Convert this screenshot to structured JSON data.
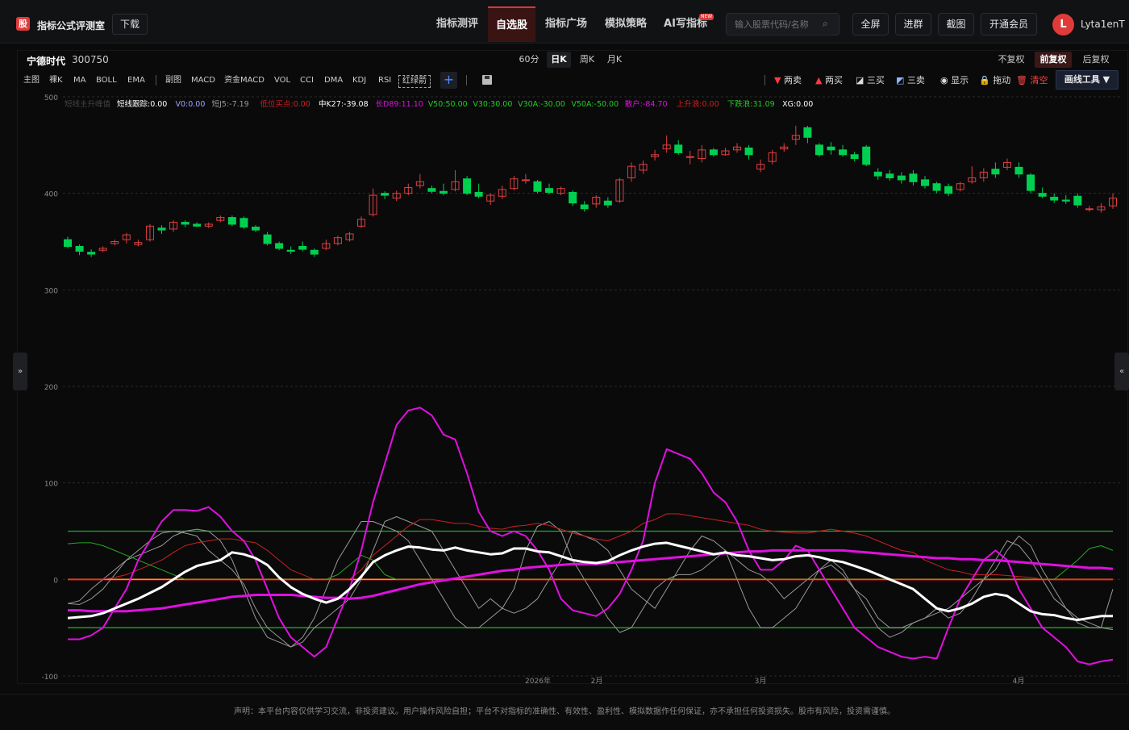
{
  "header": {
    "logo_text": "股",
    "app_title": "指标公式评测室",
    "download": "下载",
    "nav": [
      "指标测评",
      "自选股",
      "指标广场",
      "模拟策略",
      "AI写指标"
    ],
    "new_badge": "NEW",
    "search_placeholder": "输入股票代码/名称",
    "buttons": [
      "全屏",
      "进群",
      "截图",
      "开通会员"
    ],
    "avatar_letter": "L",
    "username": "Lyta1enT"
  },
  "stock": {
    "name": "宁德时代",
    "code": "300750"
  },
  "periods": [
    "60分",
    "日K",
    "周K",
    "月K"
  ],
  "adjust": [
    "不复权",
    "前复权",
    "后复权"
  ],
  "indicators_main": [
    "主图",
    "裸K",
    "MA",
    "BOLL",
    "EMA"
  ],
  "indicators_sub": [
    "副图",
    "MACD",
    "资金MACD",
    "VOL",
    "CCI",
    "DMA",
    "KDJ",
    "RSI"
  ],
  "indicator_boxed": "红绿箭",
  "add_label": "+",
  "tools": [
    {
      "label": "两卖",
      "icon": "▼",
      "color": "#ff3b3b"
    },
    {
      "label": "两买",
      "icon": "▲",
      "color": "#ff3b3b"
    },
    {
      "label": "三买",
      "icon": "◪",
      "color": "#dddddd"
    },
    {
      "label": "三卖",
      "icon": "◩",
      "color": "#8fb8ff"
    },
    {
      "label": "显示",
      "icon": "◉",
      "color": "#dddddd"
    },
    {
      "label": "拖动",
      "icon": "🔒",
      "color": "#f0c040"
    },
    {
      "label": "清空",
      "icon": "🗑",
      "color": "#ff4444"
    }
  ],
  "draw_tools": "画线工具 ▼",
  "legend": [
    {
      "text": "短线主升峰值",
      "color": "#444444"
    },
    {
      "text": "短线跟踪:0.00",
      "color": "#ffffff"
    },
    {
      "text": "V0:0.00",
      "color": "#a0a0ff"
    },
    {
      "text": "短J5:-7.19",
      "color": "#999999"
    },
    {
      "text": "低位买点:0.00",
      "color": "#cc2020"
    },
    {
      "text": "中K27:-39.08",
      "color": "#ffffff"
    },
    {
      "text": "长D89:11.10",
      "color": "#e010e0"
    },
    {
      "text": "V50:50.00",
      "color": "#22cc22"
    },
    {
      "text": "V30:30.00",
      "color": "#22cc22"
    },
    {
      "text": "V30A:-30.00",
      "color": "#22cc22"
    },
    {
      "text": "V50A:-50.00",
      "color": "#22cc22"
    },
    {
      "text": "散户:-84.70",
      "color": "#e010e0"
    },
    {
      "text": "上升浪:0.00",
      "color": "#cc2020"
    },
    {
      "text": "下跌浪:31.09",
      "color": "#22cc22"
    },
    {
      "text": "XG:0.00",
      "color": "#ffffff"
    }
  ],
  "y_ticks": [
    "500",
    "400",
    "300",
    "200",
    "100",
    "0",
    "-100"
  ],
  "x_ticks": [
    "2026年",
    "2月",
    "3月",
    "4月"
  ],
  "side_left": "»",
  "side_right": "«",
  "footer": "声明：本平台内容仅供学习交流，非投资建议。用户操作风险自担；平台不对指标的准确性、有效性、盈利性、模拟数据作任何保证，亦不承担任何投资损失。股市有风险，投资需谨慎。",
  "colors": {
    "up": "#e04040",
    "down": "#00d050",
    "accent": "#e03b3b"
  },
  "chart_data": {
    "type": "candlestick+line",
    "ylim": [
      -100,
      500
    ],
    "candles": [
      [
        352,
        345,
        355,
        343
      ],
      [
        345,
        340,
        347,
        336
      ],
      [
        339,
        337,
        342,
        334
      ],
      [
        341,
        343,
        345,
        339
      ],
      [
        348,
        350,
        352,
        346
      ],
      [
        352,
        357,
        359,
        348
      ],
      [
        347,
        349,
        352,
        345
      ],
      [
        352,
        366,
        368,
        350
      ],
      [
        364,
        362,
        367,
        358
      ],
      [
        363,
        370,
        372,
        360
      ],
      [
        370,
        368,
        372,
        365
      ],
      [
        368,
        366,
        370,
        365
      ],
      [
        366,
        368,
        370,
        364
      ],
      [
        372,
        375,
        377,
        370
      ],
      [
        375,
        368,
        377,
        366
      ],
      [
        374,
        365,
        376,
        363
      ],
      [
        365,
        362,
        367,
        360
      ],
      [
        357,
        348,
        360,
        346
      ],
      [
        348,
        343,
        350,
        341
      ],
      [
        341,
        340,
        345,
        337
      ],
      [
        345,
        342,
        350,
        340
      ],
      [
        341,
        337,
        343,
        334
      ],
      [
        343,
        348,
        352,
        341
      ],
      [
        348,
        354,
        356,
        346
      ],
      [
        352,
        358,
        360,
        350
      ],
      [
        366,
        373,
        376,
        364
      ],
      [
        378,
        398,
        405,
        376
      ],
      [
        400,
        398,
        402,
        394
      ],
      [
        395,
        400,
        403,
        392
      ],
      [
        400,
        406,
        410,
        398
      ],
      [
        408,
        412,
        420,
        405
      ],
      [
        405,
        402,
        408,
        400
      ],
      [
        402,
        400,
        410,
        398
      ],
      [
        404,
        412,
        424,
        402
      ],
      [
        415,
        400,
        418,
        398
      ],
      [
        401,
        397,
        410,
        395
      ],
      [
        392,
        398,
        400,
        388
      ],
      [
        397,
        404,
        408,
        394
      ],
      [
        405,
        415,
        418,
        403
      ],
      [
        414,
        414,
        420,
        410
      ],
      [
        412,
        402,
        414,
        400
      ],
      [
        405,
        401,
        410,
        399
      ],
      [
        400,
        405,
        407,
        398
      ],
      [
        401,
        390,
        403,
        387
      ],
      [
        388,
        384,
        392,
        381
      ],
      [
        389,
        396,
        398,
        385
      ],
      [
        392,
        388,
        396,
        385
      ],
      [
        392,
        414,
        416,
        390
      ],
      [
        416,
        428,
        432,
        412
      ],
      [
        424,
        430,
        434,
        420
      ],
      [
        438,
        440,
        445,
        434
      ],
      [
        446,
        450,
        460,
        442
      ],
      [
        450,
        442,
        455,
        440
      ],
      [
        438,
        438,
        444,
        430
      ],
      [
        436,
        445,
        450,
        432
      ],
      [
        445,
        440,
        447,
        438
      ],
      [
        440,
        444,
        447,
        439
      ],
      [
        445,
        448,
        452,
        442
      ],
      [
        447,
        440,
        450,
        435
      ],
      [
        425,
        430,
        435,
        422
      ],
      [
        433,
        442,
        445,
        430
      ],
      [
        446,
        448,
        452,
        443
      ],
      [
        456,
        460,
        470,
        450
      ],
      [
        468,
        458,
        470,
        452
      ],
      [
        450,
        440,
        452,
        438
      ],
      [
        448,
        445,
        453,
        440
      ],
      [
        445,
        440,
        450,
        438
      ],
      [
        440,
        436,
        443,
        433
      ],
      [
        448,
        430,
        450,
        428
      ],
      [
        422,
        418,
        426,
        414
      ],
      [
        420,
        416,
        424,
        413
      ],
      [
        418,
        414,
        422,
        410
      ],
      [
        420,
        412,
        424,
        408
      ],
      [
        414,
        408,
        418,
        405
      ],
      [
        410,
        403,
        412,
        400
      ],
      [
        407,
        400,
        410,
        397
      ],
      [
        404,
        410,
        412,
        402
      ],
      [
        412,
        416,
        428,
        410
      ],
      [
        416,
        422,
        426,
        412
      ],
      [
        425,
        420,
        432,
        416
      ],
      [
        427,
        432,
        436,
        424
      ],
      [
        427,
        420,
        432,
        416
      ],
      [
        419,
        403,
        421,
        400
      ],
      [
        400,
        397,
        406,
        395
      ],
      [
        396,
        393,
        400,
        390
      ],
      [
        393,
        392,
        398,
        389
      ],
      [
        397,
        388,
        400,
        385
      ],
      [
        384,
        384,
        387,
        381
      ],
      [
        383,
        386,
        390,
        380
      ],
      [
        387,
        395,
        400,
        384
      ]
    ],
    "series": [
      {
        "name": "短线跟踪",
        "color": "#ffffff",
        "width": 3,
        "values": [
          -40,
          -39,
          -38,
          -35,
          -30,
          -25,
          -20,
          -14,
          -8,
          0,
          8,
          14,
          17,
          20,
          28,
          26,
          22,
          15,
          2,
          -8,
          -15,
          -20,
          -24,
          -20,
          -10,
          3,
          18,
          25,
          30,
          34,
          33,
          31,
          30,
          33,
          30,
          28,
          26,
          27,
          32,
          32,
          29,
          28,
          24,
          20,
          18,
          17,
          19,
          25,
          30,
          34,
          37,
          38,
          35,
          32,
          29,
          26,
          28,
          25,
          24,
          22,
          20,
          21,
          24,
          25,
          23,
          20,
          18,
          14,
          10,
          5,
          0,
          -5,
          -10,
          -20,
          -30,
          -33,
          -30,
          -25,
          -18,
          -15,
          -17,
          -25,
          -33,
          -36,
          -37,
          -40,
          -42,
          -40,
          -38,
          -38
        ]
      },
      {
        "name": "长D89",
        "color": "#e010e0",
        "width": 3,
        "values": [
          -32,
          -32,
          -33,
          -33,
          -33,
          -33,
          -32,
          -31,
          -30,
          -28,
          -26,
          -24,
          -22,
          -20,
          -18,
          -17,
          -16,
          -16,
          -16,
          -16,
          -17,
          -18,
          -19,
          -19,
          -20,
          -19,
          -17,
          -14,
          -11,
          -8,
          -5,
          -3,
          -1,
          1,
          3,
          5,
          7,
          9,
          10,
          12,
          13,
          14,
          15,
          16,
          16,
          16,
          17,
          18,
          19,
          20,
          21,
          22,
          23,
          24,
          25,
          26,
          27,
          28,
          29,
          29,
          30,
          30,
          30,
          30,
          30,
          30,
          30,
          29,
          28,
          27,
          26,
          25,
          24,
          23,
          22,
          22,
          21,
          21,
          20,
          20,
          19,
          18,
          17,
          16,
          15,
          14,
          13,
          12,
          12,
          11
        ]
      },
      {
        "name": "散户",
        "color": "#e010e0",
        "width": 2,
        "values": [
          -62,
          -62,
          -58,
          -50,
          -30,
          -10,
          20,
          40,
          60,
          72,
          72,
          71,
          75,
          65,
          50,
          40,
          20,
          -10,
          -40,
          -60,
          -70,
          -80,
          -70,
          -40,
          -10,
          30,
          80,
          120,
          160,
          175,
          178,
          170,
          150,
          145,
          110,
          70,
          50,
          45,
          50,
          45,
          30,
          10,
          -20,
          -32,
          -35,
          -38,
          -30,
          -15,
          10,
          40,
          100,
          135,
          130,
          125,
          110,
          90,
          80,
          60,
          30,
          10,
          10,
          20,
          35,
          30,
          10,
          -10,
          -30,
          -50,
          -60,
          -70,
          -75,
          -80,
          -82,
          -80,
          -82,
          -50,
          -20,
          0,
          20,
          30,
          20,
          -10,
          -30,
          -50,
          -60,
          -70,
          -85,
          -88,
          -85,
          -83
        ]
      },
      {
        "name": "中K27",
        "color": "#999999",
        "width": 1,
        "values": [
          -25,
          -26,
          -20,
          -10,
          5,
          20,
          30,
          40,
          48,
          50,
          48,
          45,
          30,
          20,
          10,
          -5,
          -30,
          -50,
          -60,
          -70,
          -65,
          -50,
          -40,
          -30,
          -20,
          0,
          30,
          60,
          65,
          60,
          55,
          50,
          30,
          10,
          -10,
          -30,
          -20,
          -30,
          -35,
          -30,
          -20,
          0,
          20,
          50,
          45,
          40,
          30,
          10,
          -10,
          -20,
          -30,
          -10,
          10,
          30,
          45,
          40,
          30,
          20,
          10,
          5,
          -5,
          -20,
          -10,
          0,
          10,
          15,
          5,
          -10,
          -20,
          -40,
          -50,
          -50,
          -45,
          -40,
          -30,
          -40,
          -35,
          -20,
          0,
          20,
          40,
          35,
          20,
          0,
          -20,
          -30,
          -40,
          -45,
          -50,
          -52
        ]
      },
      {
        "name": "短J5",
        "color": "#999999",
        "width": 1,
        "values": [
          -25,
          -22,
          -10,
          0,
          10,
          20,
          25,
          30,
          35,
          45,
          50,
          52,
          50,
          40,
          20,
          -10,
          -40,
          -60,
          -65,
          -70,
          -60,
          -40,
          -10,
          20,
          40,
          60,
          60,
          55,
          50,
          40,
          20,
          0,
          -20,
          -40,
          -50,
          -50,
          -40,
          -30,
          -10,
          30,
          55,
          60,
          50,
          20,
          0,
          -20,
          -40,
          -55,
          -50,
          -30,
          -10,
          0,
          5,
          5,
          10,
          20,
          30,
          0,
          -30,
          -50,
          -50,
          -40,
          -30,
          -10,
          10,
          20,
          10,
          -10,
          -30,
          -50,
          -60,
          -55,
          -45,
          -40,
          -35,
          -30,
          -20,
          -10,
          0,
          10,
          30,
          45,
          35,
          10,
          -10,
          -30,
          -45,
          -50,
          -50,
          -10
        ]
      },
      {
        "name": "低位买点",
        "color": "#cc2020",
        "width": 1,
        "values": [
          0,
          0,
          0,
          0,
          2,
          5,
          10,
          15,
          20,
          28,
          35,
          38,
          40,
          42,
          42,
          40,
          38,
          30,
          20,
          10,
          5,
          0,
          0,
          0,
          0,
          10,
          25,
          35,
          45,
          55,
          62,
          62,
          60,
          58,
          58,
          55,
          53,
          52,
          55,
          56,
          58,
          56,
          52,
          48,
          45,
          42,
          40,
          45,
          50,
          58,
          62,
          68,
          68,
          66,
          64,
          62,
          60,
          58,
          56,
          52,
          50,
          49,
          48,
          48,
          50,
          52,
          50,
          48,
          45,
          40,
          35,
          30,
          28,
          20,
          15,
          10,
          8,
          5,
          5,
          5,
          4,
          3,
          2,
          0,
          0,
          0,
          0,
          0,
          0,
          0
        ]
      },
      {
        "name": "下跌浪",
        "color": "#22aa22",
        "width": 1,
        "values": [
          37,
          38,
          38,
          35,
          30,
          25,
          20,
          15,
          10,
          5,
          0,
          0,
          0,
          0,
          0,
          0,
          0,
          0,
          0,
          0,
          0,
          0,
          0,
          5,
          15,
          25,
          20,
          5,
          0,
          0,
          0,
          0,
          0,
          0,
          0,
          0,
          0,
          0,
          0,
          0,
          0,
          0,
          0,
          0,
          0,
          0,
          0,
          0,
          0,
          0,
          0,
          0,
          0,
          0,
          0,
          0,
          0,
          0,
          0,
          0,
          0,
          0,
          0,
          0,
          0,
          0,
          0,
          0,
          0,
          0,
          0,
          0,
          0,
          0,
          0,
          0,
          0,
          0,
          0,
          0,
          0,
          0,
          0,
          0,
          0,
          10,
          20,
          32,
          35,
          30
        ]
      }
    ],
    "levels": [
      {
        "name": "V50",
        "value": 50,
        "color": "#22aa22"
      },
      {
        "name": "V50A",
        "value": -50,
        "color": "#22aa22"
      },
      {
        "name": "zero",
        "value": 0,
        "color": "#ff2020"
      },
      {
        "name": "base",
        "value": 0,
        "color": "#c8b400"
      }
    ]
  }
}
